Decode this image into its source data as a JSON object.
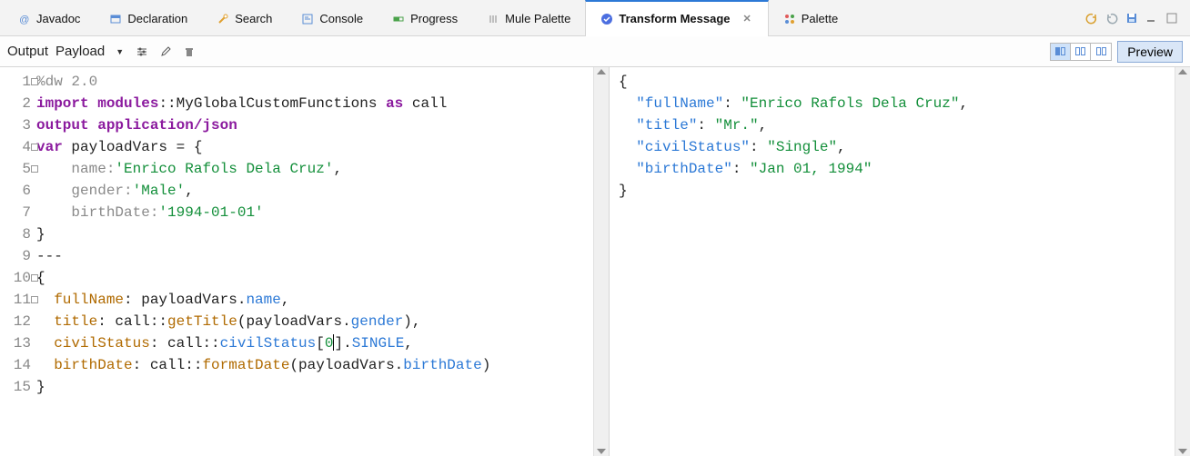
{
  "tabs": [
    {
      "label": "Javadoc"
    },
    {
      "label": "Declaration"
    },
    {
      "label": "Search"
    },
    {
      "label": "Console"
    },
    {
      "label": "Progress"
    },
    {
      "label": "Mule Palette"
    },
    {
      "label": "Transform Message"
    },
    {
      "label": "Palette"
    }
  ],
  "activeTabIndex": 6,
  "out_toolbar": {
    "output_label": "Output",
    "payload_label": "Payload"
  },
  "preview_label": "Preview",
  "code_lines": {
    "l1": "%dw 2.0",
    "l2_import": "import",
    "l2_mod": "modules",
    "l2_rest": "::MyGlobalCustomFunctions ",
    "l2_as": "as",
    "l2_call": " call",
    "l3_output": "output",
    "l3_app": " application/json",
    "l4_var": "var",
    "l4_rest": " payloadVars = {",
    "l5a": "    name:",
    "l5b": "'Enrico Rafols Dela Cruz'",
    "l6a": "    gender:",
    "l6b": "'Male'",
    "l7a": "    birthDate:",
    "l7b": "'1994-01-01'",
    "l8": "}",
    "l9": "---",
    "l10": "{",
    "l11_key": "  fullName",
    "l11_mid": ": payloadVars.",
    "l11_name": "name",
    "l12_key": "  title",
    "l12_mid1": ": call::",
    "l12_func": "getTitle",
    "l12_mid2": "(payloadVars.",
    "l12_gender": "gender",
    "l12_end": "),",
    "l13_key": "  civilStatus",
    "l13_mid1": ": call::",
    "l13_cs": "civilStatus",
    "l13_br1": "[",
    "l13_zero": "0",
    "l13_br2": "].",
    "l13_single": "SINGLE",
    "l14_key": "  birthDate",
    "l14_mid1": ": call::",
    "l14_func": "formatDate",
    "l14_mid2": "(payloadVars.",
    "l14_bd": "birthDate",
    "l14_end": ")",
    "l15": "}"
  },
  "line_numbers": {
    "n1": "1",
    "n2": "2",
    "n3": "3",
    "n4": "4",
    "n5": "5",
    "n6": "6",
    "n7": "7",
    "n8": "8",
    "n9": "9",
    "n10": "10",
    "n11": "11",
    "n12": "12",
    "n13": "13",
    "n14": "14",
    "n15": "15"
  },
  "json_output": {
    "open": "{",
    "k1": "\"fullName\"",
    "v1": "\"Enrico Rafols Dela Cruz\"",
    "k2": "\"title\"",
    "v2": "\"Mr.\"",
    "k3": "\"civilStatus\"",
    "v3": "\"Single\"",
    "k4": "\"birthDate\"",
    "v4": "\"Jan 01, 1994\"",
    "close": "}"
  }
}
